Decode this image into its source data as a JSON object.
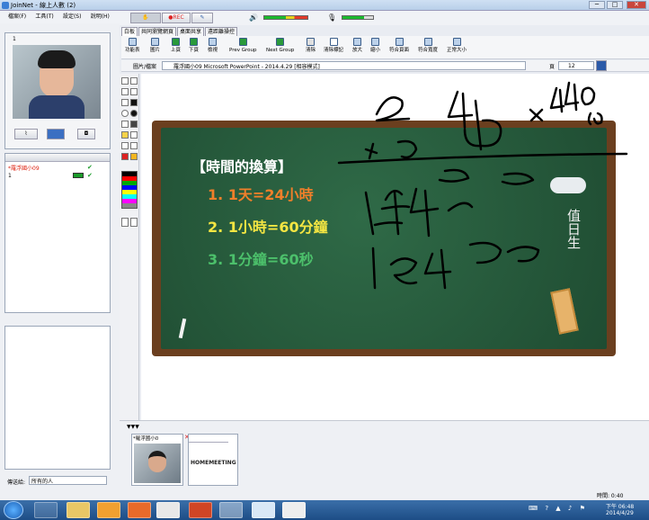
{
  "window": {
    "title": "JoinNet - 線上人數 (2)",
    "minimize": "─",
    "maximize": "□",
    "close": "✕"
  },
  "menu": [
    "檔案(F)",
    "工具(T)",
    "設定(S)",
    "說明(H)"
  ],
  "controls": {
    "rec_label": "●REC"
  },
  "user_panel": {
    "number": "1",
    "rows": [
      {
        "name": "*羅浮國小09",
        "mark": "✔"
      },
      {
        "name": "1",
        "mark": "✔"
      }
    ]
  },
  "send_to": {
    "label": "傳送給:",
    "value": "所有的人"
  },
  "tabs": [
    "白板",
    "共同瀏覽網頁",
    "桌面共享",
    "遠距離操控"
  ],
  "toolbar": [
    "功能表",
    "圖片",
    "上頁",
    "下頁",
    "檢視",
    "Prev Group",
    "Next Group",
    "清除",
    "清除標記",
    "放大",
    "縮小",
    "符合頁面",
    "符合寬度",
    "正常大小"
  ],
  "path": {
    "label": "圖片/檔案",
    "file": "羅浮國小09 Microsoft PowerPoint - 2014.4.29 [相容模式]",
    "page_label": "頁",
    "page_value": "12"
  },
  "slide": {
    "title": "【時間的換算】",
    "items": [
      {
        "text": "1.  1天=24小時",
        "color": "#f07f2a"
      },
      {
        "text": "2.  1小時=60分鐘",
        "color": "#f5e642"
      },
      {
        "text": "3.  1分鐘=60秒",
        "color": "#4cc06b"
      }
    ],
    "side_text": "值日生"
  },
  "thumbs": [
    {
      "label": "*羅浮國小0"
    },
    {
      "label": "HOMEMEETING"
    }
  ],
  "status": {
    "time": "時間: 0:40"
  },
  "clock": {
    "time": "下午 06:48",
    "date": "2014/4/29"
  }
}
